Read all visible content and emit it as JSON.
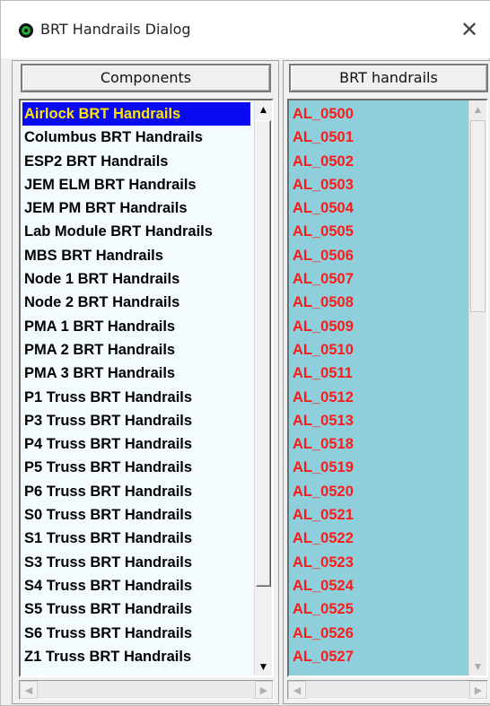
{
  "window": {
    "title": "BRT Handrails Dialog",
    "close_glyph": "✕",
    "icon": "app-globe-icon"
  },
  "components": {
    "header": "Components",
    "selected_index": 0,
    "items": [
      "Airlock BRT Handrails",
      "Columbus BRT Handrails",
      "ESP2 BRT Handrails",
      "JEM ELM BRT Handrails",
      "JEM PM BRT Handrails",
      "Lab Module BRT Handrails",
      "MBS BRT Handrails",
      "Node 1 BRT Handrails",
      "Node 2 BRT Handrails",
      "PMA 1 BRT Handrails",
      "PMA 2 BRT Handrails",
      "PMA 3 BRT Handrails",
      "P1 Truss BRT Handrails",
      "P3 Truss BRT Handrails",
      "P4 Truss BRT Handrails",
      "P5 Truss BRT Handrails",
      "P6 Truss BRT Handrails",
      "S0 Truss BRT Handrails",
      "S1 Truss BRT Handrails",
      "S3 Truss BRT Handrails",
      "S4 Truss BRT Handrails",
      "S5 Truss BRT Handrails",
      "S6 Truss BRT Handrails",
      "Z1 Truss BRT Handrails"
    ]
  },
  "handrails": {
    "header": "BRT handrails",
    "items": [
      "AL_0500",
      "AL_0501",
      "AL_0502",
      "AL_0503",
      "AL_0504",
      "AL_0505",
      "AL_0506",
      "AL_0507",
      "AL_0508",
      "AL_0509",
      "AL_0510",
      "AL_0511",
      "AL_0512",
      "AL_0513",
      "AL_0518",
      "AL_0519",
      "AL_0520",
      "AL_0521",
      "AL_0522",
      "AL_0523",
      "AL_0524",
      "AL_0525",
      "AL_0526",
      "AL_0527"
    ]
  },
  "scrollbars": {
    "up": "▲",
    "down": "▼",
    "left": "◀",
    "right": "▶"
  },
  "colors": {
    "selection_bg": "#0a0af0",
    "selection_text": "#ffe600",
    "handrail_text": "#ff1a1a",
    "handrail_bg": "#8ecfdb"
  }
}
